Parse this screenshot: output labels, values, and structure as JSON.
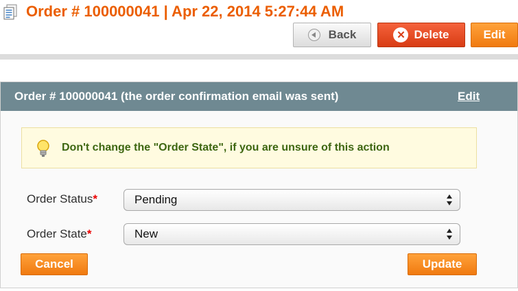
{
  "page": {
    "title": "Order # 100000041 | Apr 22, 2014 5:27:44 AM"
  },
  "toolbar": {
    "back_label": "Back",
    "delete_label": "Delete",
    "edit_label": "Edit"
  },
  "form_box": {
    "header_title": "Order # 100000041 (the order confirmation email was sent)",
    "header_edit": "Edit",
    "notice": "Don't change the \"Order State\", if you are unsure of this action",
    "fields": [
      {
        "label": "Order Status",
        "required_mark": "*",
        "value": "Pending"
      },
      {
        "label": "Order State",
        "required_mark": "*",
        "value": "New"
      }
    ],
    "cancel_label": "Cancel",
    "update_label": "Update"
  },
  "colors": {
    "title_orange": "#eb5e00",
    "button_orange": "#f07a10",
    "delete_red": "#d83c14",
    "box_header": "#6f8992",
    "notice_text": "#3d6611"
  }
}
